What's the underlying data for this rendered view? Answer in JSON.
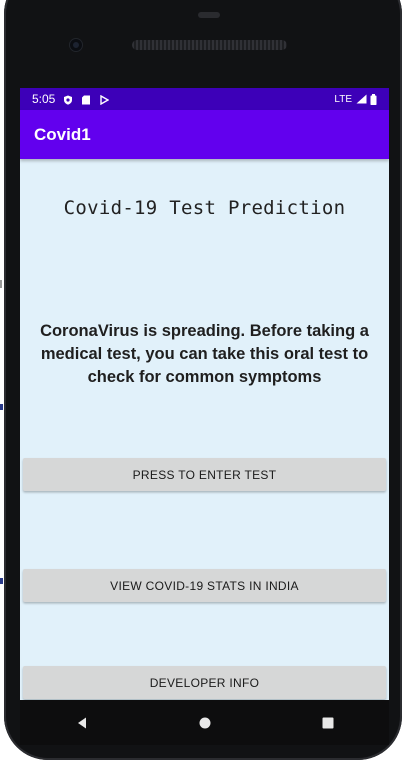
{
  "status_bar": {
    "time": "5:05",
    "network": "LTE",
    "icons": [
      "shield-icon",
      "sd-card-icon",
      "play-icon",
      "signal-icon",
      "battery-icon"
    ]
  },
  "app_bar": {
    "title": "Covid1"
  },
  "main": {
    "title": "Covid-19 Test Prediction",
    "message": "CoronaVirus is spreading. Before taking a medical test, you can take this oral test to check for common symptoms",
    "buttons": {
      "enter_test": "PRESS TO ENTER TEST",
      "stats": "VIEW COVID-19 STATS IN INDIA",
      "developer": "DEVELOPER INFO"
    }
  },
  "nav_bar": {
    "icons": [
      "back-icon",
      "home-icon",
      "recents-icon"
    ]
  },
  "colors": {
    "status_bar": "#3d00b8",
    "app_bar": "#6200ee",
    "background": "#e1f1fa",
    "button": "#d6d7d7"
  }
}
